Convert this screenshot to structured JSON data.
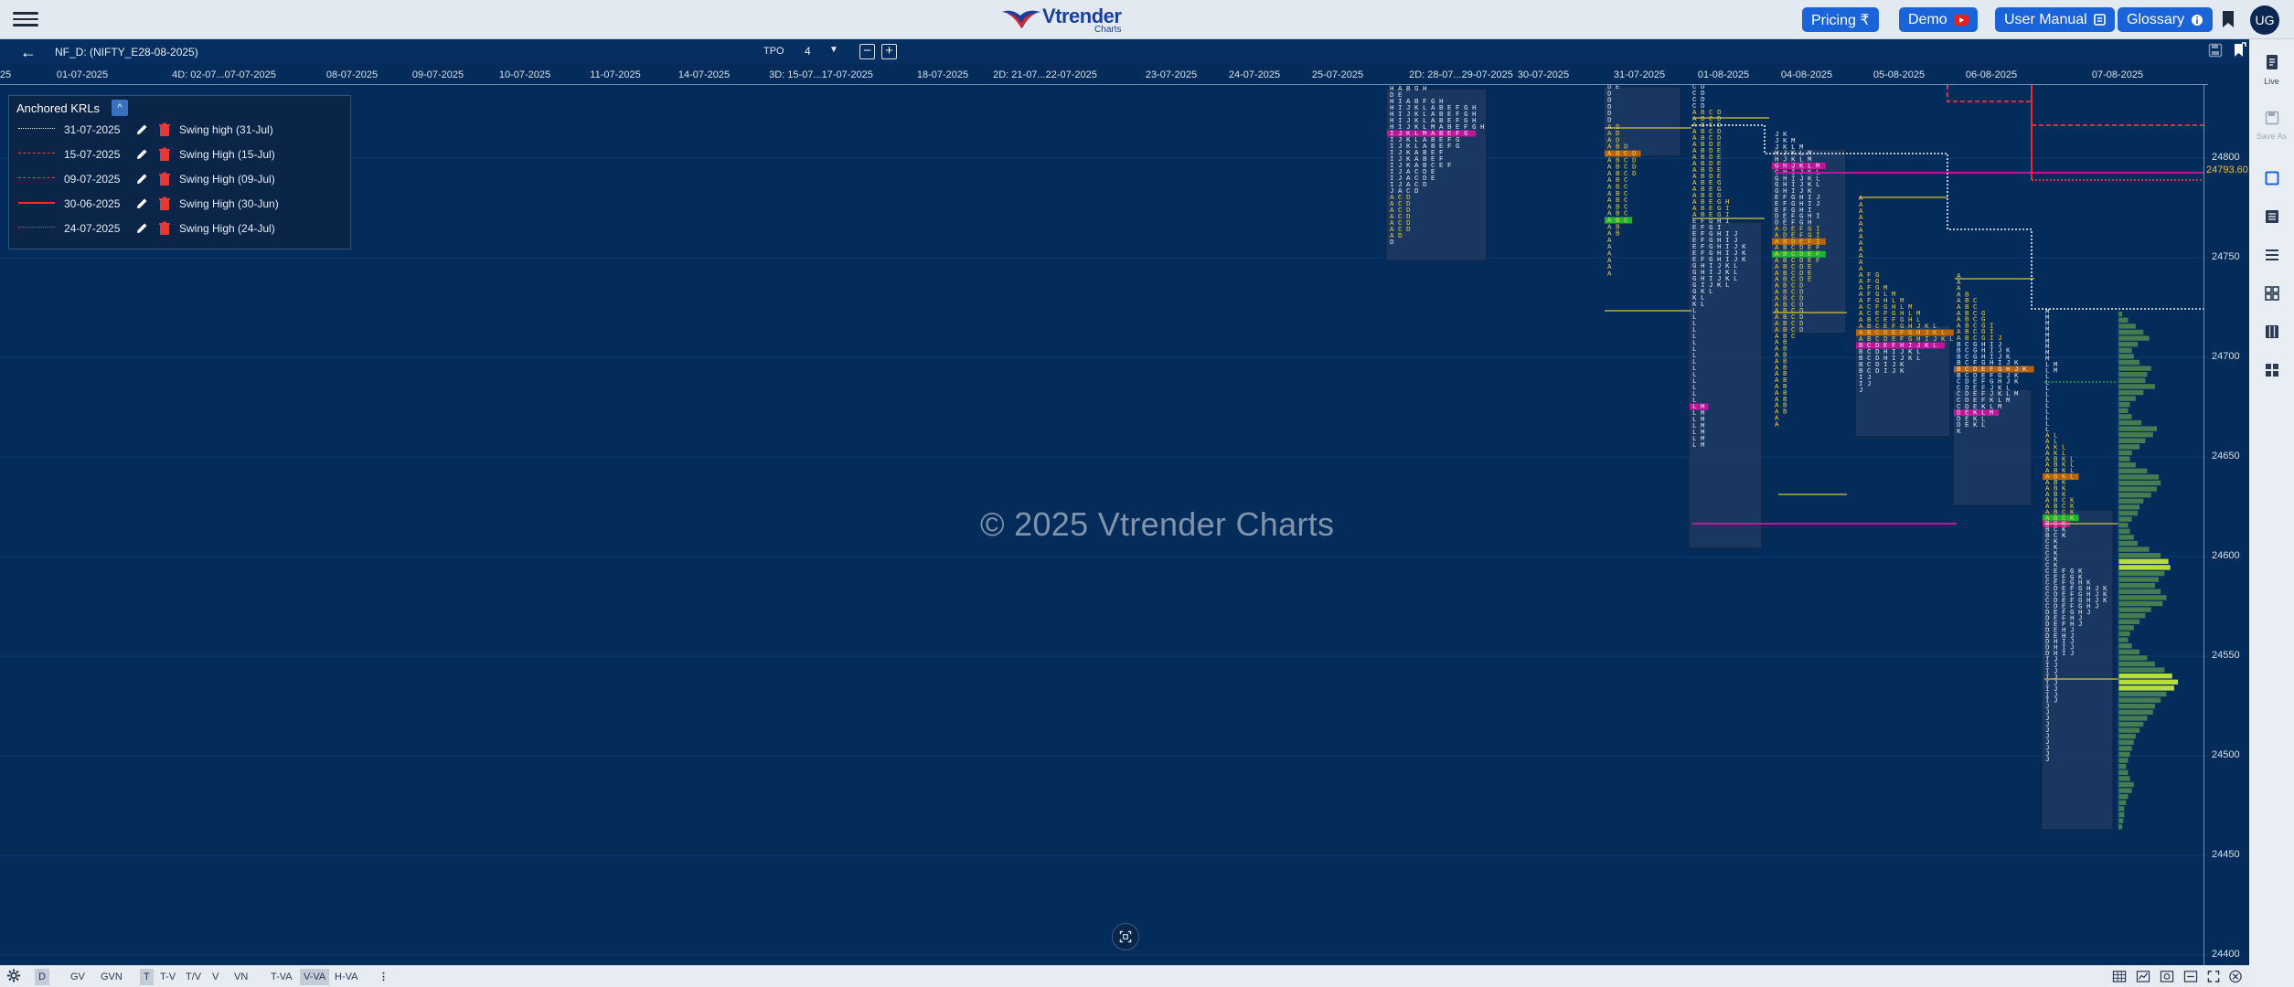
{
  "topbar": {
    "logo_brand": "Vtrender",
    "logo_sub": "Charts",
    "buttons": [
      {
        "label": "Pricing ₹",
        "icon": "rupee-icon"
      },
      {
        "label": "Demo",
        "icon": "youtube-icon"
      },
      {
        "label": "User Manual",
        "icon": "manual-icon"
      },
      {
        "label": "Glossary",
        "icon": "info-icon"
      }
    ],
    "avatar": "UG"
  },
  "header": {
    "symbol": "NF_D: (NIFTY_E28-08-2025)",
    "tpo_label": "TPO",
    "tpo_value": "4"
  },
  "date_axis": [
    "25",
    "01-07-2025",
    "4D: 02-07...07-07-2025",
    "08-07-2025",
    "09-07-2025",
    "10-07-2025",
    "11-07-2025",
    "14-07-2025",
    "3D: 15-07...17-07-2025",
    "18-07-2025",
    "2D: 21-07...22-07-2025",
    "23-07-2025",
    "24-07-2025",
    "25-07-2025",
    "2D: 28-07...29-07-2025",
    "30-07-2025",
    "31-07-2025",
    "01-08-2025",
    "04-08-2025",
    "05-08-2025",
    "06-08-2025",
    "07-08-2025"
  ],
  "price_axis": [
    "24800",
    "24750",
    "24700",
    "24650",
    "24600",
    "24550",
    "24500",
    "24450",
    "24400"
  ],
  "price_highlight": "24793.60",
  "watermark": "© 2025 Vtrender Charts",
  "krl": {
    "title": "Anchored KRLs",
    "rows": [
      {
        "date": "31-07-2025",
        "name": "Swing high (31-Jul)",
        "style": "dotted",
        "color": "#f2f4f8"
      },
      {
        "date": "15-07-2025",
        "name": "Swing High (15-Jul)",
        "style": "dashed",
        "color": "#ff3b4b"
      },
      {
        "date": "09-07-2025",
        "name": "Swing High (09-Jul)",
        "style": "dashed",
        "color": "#ff3b4b"
      },
      {
        "date": "30-06-2025",
        "name": "Swing High (30-Jun)",
        "style": "solid",
        "color": "#ff2a2a"
      },
      {
        "date": "24-07-2025",
        "name": "Swing High (24-Jul)",
        "style": "dotted",
        "color": "#ff3b4b"
      }
    ]
  },
  "tpo_profiles": [
    {
      "name": "2D: 28-07...29-07-2025",
      "letters": [
        "H A B G H",
        "D E",
        "H I A B F G H",
        "H I J K L A B E F G H",
        "H I J K L A B E F G H",
        "H I J K L A B E F G H",
        "H I J K L M A B E F G H",
        "I J K L M A B E F G",
        "I J K L A B E F G",
        "I J K L A B E F G",
        "I J K A B E F",
        "I J K A B E F",
        "I J K A B C E F",
        "I J A C D E",
        "I J A C D E",
        "I J A C D",
        "J A C D",
        "A C D",
        "A C D",
        "A C D",
        "A C D",
        "A C D",
        "A C D",
        "A D",
        "D"
      ]
    },
    {
      "name": "31-07-2025",
      "letters": [
        "D E",
        "D",
        "D",
        "D",
        "D",
        "D",
        "A D",
        "A D",
        "A D",
        "A B D",
        "A B C D",
        "A B C D",
        "A B C D",
        "A B C D",
        "A B C",
        "A B C",
        "A B C",
        "A B C",
        "A B C",
        "A B C",
        "A B C",
        "A B",
        "A B",
        "A",
        "A",
        "A",
        "A",
        "A",
        "A"
      ]
    },
    {
      "name": "01-08-2025",
      "letters": [
        "C D",
        "C D",
        "C D",
        "C D",
        "A B C D",
        "A B C D",
        "A B C D",
        "A B C D",
        "A B C D",
        "A B D E",
        "A B D E",
        "A B D E",
        "A B D E",
        "A B D E",
        "A B D E",
        "A B E G",
        "A B E G",
        "A B E G",
        "A B E G H",
        "A B E G I",
        "A B E G I",
        "E F G H I",
        "E F G I",
        "E F G H I J",
        "E F G H I J",
        "E F G H I J K",
        "E F G H I J K",
        "E F G H I J K",
        "G H I J K L",
        "G H I J K L",
        "G H I J K L",
        "G I J K L",
        "G K L",
        "K L",
        "K L",
        "L",
        "L",
        "L",
        "L",
        "L",
        "L",
        "L",
        "L",
        "L",
        "L",
        "L",
        "L",
        "L",
        "L",
        "L",
        "L M",
        "L M",
        "L M",
        "L M",
        "L M",
        "L M",
        "L M"
      ]
    },
    {
      "name": "04-08-2025",
      "letters": [
        "J K",
        "J K M",
        "J K L M",
        "H J K L M",
        "H J K L M",
        "G H J K L M",
        "G H I J K L",
        "G H I J K L",
        "G H I J K L",
        "G H I J K",
        "E F G H I J",
        "E F G H I J",
        "E F G H I",
        "D E F G H I",
        "D E F G H",
        "A D E F G I",
        "A D E F G I",
        "A B D E F I",
        "A B C D E F",
        "A B C D E F",
        "A B C D E F",
        "A B C D E",
        "A B C D E",
        "A B C D E",
        "A B C D",
        "A B C D",
        "A B C D",
        "A B C D",
        "A B C D",
        "A B C D",
        "A B C D",
        "A B C D",
        "A B C",
        "A B",
        "A B",
        "A B",
        "A B",
        "A B",
        "A B",
        "A B",
        "A B",
        "A B",
        "A B",
        "A B",
        "A B",
        "A",
        "A"
      ]
    },
    {
      "name": "05-08-2025",
      "letters": [
        "A",
        "A",
        "A",
        "A",
        "A",
        "A",
        "A",
        "A",
        "A",
        "A",
        "A",
        "A",
        "A F G",
        "A F G",
        "A F G M",
        "A F G L M",
        "A F G H L M",
        "A C F G H L M",
        "A C E F G H L M",
        "A B C E F G H L",
        "A B C E F G H J K L",
        "A B C D E F G H J K L",
        "A B C D E F G H I J K L",
        "B C D E F H I J K L",
        "B C D H I J K L",
        "B C D H I J K L",
        "B C D I J K",
        "B C D I J K",
        "I J",
        "I J",
        "J"
      ]
    },
    {
      "name": "06-08-2025",
      "letters": [
        "A",
        "A",
        "A",
        "A B",
        "A B C",
        "A B C",
        "A B C G",
        "A B C G",
        "A B C G I",
        "A B C G I",
        "A B C G I J",
        "B C G H I J",
        "B C G H I J K",
        "B C G H I J K",
        "B C F G H I J K",
        "B C D E F G H J K",
        "B C D E F G J K",
        "C D E F G H J K",
        "C D E F J K L",
        "C D E F J K L M",
        "C D E F K L M",
        "C D E K L M",
        "D E K L M",
        "D E K L",
        "D E K L",
        "K"
      ]
    },
    {
      "name": "07-08-2025",
      "letters": [
        "M",
        "M",
        "M",
        "M",
        "M",
        "M",
        "M",
        "M",
        "M",
        "L M",
        "L M",
        "L",
        "L",
        "L",
        "L",
        "L",
        "L",
        "L",
        "L",
        "L",
        "L",
        "A L",
        "A L",
        "A K L",
        "A K L",
        "A B K L",
        "A B K L",
        "A B K L",
        "A B K L",
        "A B K",
        "A B K",
        "A B K",
        "A B C K",
        "A B C K",
        "A B C K",
        "A B C K",
        "B C K",
        "B C K",
        "B C K",
        "C K",
        "C K",
        "C K",
        "C K",
        "C K",
        "C E F G K",
        "C E F G K",
        "C E F G H K",
        "C D E F G H J K",
        "C D E F G H J K",
        "C D E F G H J K",
        "C D E F G H J",
        "D E F G H J",
        "D E F H J",
        "D E F H J",
        "D E H J",
        "D E H J",
        "D H I J",
        "D H I J",
        "D H I J",
        "I J",
        "I J",
        "I J",
        "I J",
        "I J",
        "I J",
        "I J",
        "I J",
        "J",
        "J",
        "J",
        "J",
        "J",
        "J",
        "J",
        "J",
        "J",
        "J"
      ]
    }
  ],
  "bottombar": [
    "D",
    "GV",
    "GVN",
    "T",
    "T-V",
    "T/V",
    "V",
    "VN",
    "T-VA",
    "V-VA",
    "H-VA"
  ],
  "right_sidebar": [
    {
      "label": "Live",
      "icon": "live-doc-icon"
    },
    {
      "label": "Save As",
      "icon": "save-as-icon"
    }
  ]
}
